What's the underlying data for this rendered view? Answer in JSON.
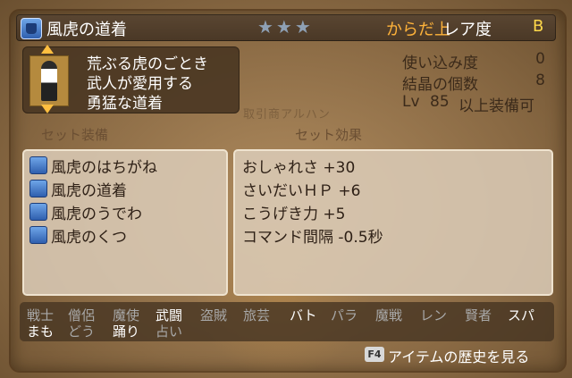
{
  "item": {
    "name": "風虎の道着",
    "stars": "★★★",
    "slot": "からだ上",
    "rarity_label": "レア度",
    "rarity_value": "B",
    "description": [
      "荒ぶる虎のごとき",
      "武人が愛用する",
      "勇猛な道着"
    ]
  },
  "stats": {
    "usage_label": "使い込み度",
    "usage_value": "0",
    "crystal_label": "結晶の個数",
    "crystal_value": "8",
    "level_label": "Lv",
    "level_value": "85",
    "level_suffix": "以上装備可"
  },
  "background_text": "取引商アルハン",
  "sections": {
    "set_equipment": "セット装備",
    "set_effect": "セット効果"
  },
  "set_items": [
    {
      "label": "風虎のはちがね",
      "icon": "head-armor-icon"
    },
    {
      "label": "風虎の道着",
      "icon": "body-armor-icon"
    },
    {
      "label": "風虎のうでわ",
      "icon": "arm-armor-icon"
    },
    {
      "label": "風虎のくつ",
      "icon": "boots-icon"
    }
  ],
  "set_effects": [
    "おしゃれさ +30",
    "さいだいＨＰ +6",
    "こうげき力 +5",
    "コマンド間隔 -0.5秒"
  ],
  "jobs_row1": [
    {
      "label": "戦士",
      "equippable": false
    },
    {
      "label": "僧侶",
      "equippable": false
    },
    {
      "label": "魔使",
      "equippable": false
    },
    {
      "label": "武闘",
      "equippable": true
    },
    {
      "label": "盗賊",
      "equippable": false
    },
    {
      "label": "旅芸",
      "equippable": false
    },
    {
      "label": "バト",
      "equippable": true
    },
    {
      "label": "パラ",
      "equippable": false
    },
    {
      "label": "魔戦",
      "equippable": false
    },
    {
      "label": "レン",
      "equippable": false
    },
    {
      "label": "賢者",
      "equippable": false
    },
    {
      "label": "スパ",
      "equippable": true
    }
  ],
  "jobs_row2": [
    {
      "label": "まも",
      "equippable": true
    },
    {
      "label": "どう",
      "equippable": false
    },
    {
      "label": "踊り",
      "equippable": true
    },
    {
      "label": "占い",
      "equippable": false
    }
  ],
  "footer": {
    "key": "F4",
    "history_label": "アイテムの歴史を見る"
  },
  "colors": {
    "slot": "#ffb33a",
    "rarity": "#ffd84a",
    "job_on": "#ffffff",
    "job_off": "#a8a8a8"
  }
}
